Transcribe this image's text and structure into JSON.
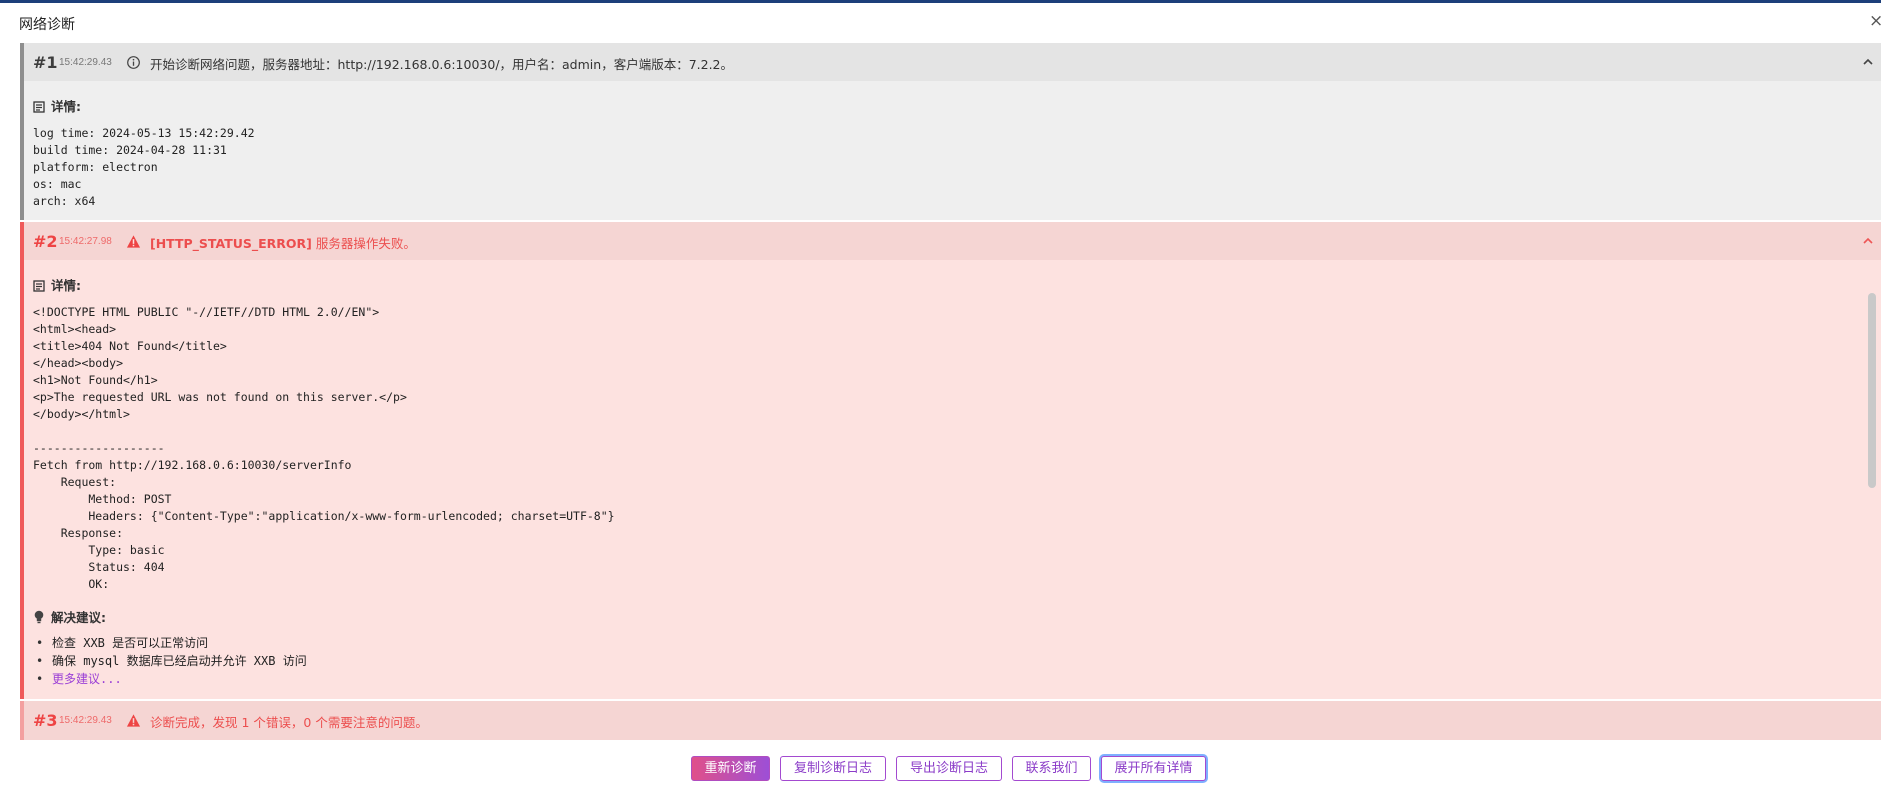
{
  "dialog": {
    "title": "网络诊断",
    "close_glyph": "×"
  },
  "colors": {
    "accent": "#9b3fd6",
    "error": "#ee4444",
    "info_border": "#8e8e8e",
    "error_bg": "#fde2e0"
  },
  "logs": [
    {
      "num": "#1",
      "time": "15:42:29.43",
      "icon": "info-icon",
      "message": "开始诊断网络问题，服务器地址：http://192.168.0.6:10030/，用户名：admin，客户端版本：7.2.2。",
      "detail_label": "详情:",
      "detail": "log time: 2024-05-13 15:42:29.42\nbuild time: 2024-04-28 11:31\nplatform: electron\nos: mac\narch: x64"
    },
    {
      "num": "#2",
      "time": "15:42:27.98",
      "icon": "warning-icon",
      "code": "[HTTP_STATUS_ERROR]",
      "message": " 服务器操作失败。",
      "detail_label": "详情:",
      "detail": "<!DOCTYPE HTML PUBLIC \"-//IETF//DTD HTML 2.0//EN\">\n<html><head>\n<title>404 Not Found</title>\n</head><body>\n<h1>Not Found</h1>\n<p>The requested URL was not found on this server.</p>\n</body></html>\n\n-------------------\nFetch from http://192.168.0.6:10030/serverInfo\n    Request:\n        Method: POST\n        Headers: {\"Content-Type\":\"application/x-www-form-urlencoded; charset=UTF-8\"}\n    Response:\n        Type: basic\n        Status: 404\n        OK:",
      "tips_label": "解决建议:",
      "tips": [
        "检查 XXB 是否可以正常访问",
        "确保 mysql 数据库已经启动并允许 XXB 访问"
      ],
      "more_tips": "更多建议..."
    },
    {
      "num": "#3",
      "time": "15:42:29.43",
      "icon": "warning-icon",
      "message": "诊断完成，发现 1 个错误，0 个需要注意的问题。"
    }
  ],
  "buttons": {
    "rediagnose": "重新诊断",
    "copy_log": "复制诊断日志",
    "export_log": "导出诊断日志",
    "contact": "联系我们",
    "expand_all": "展开所有详情"
  }
}
